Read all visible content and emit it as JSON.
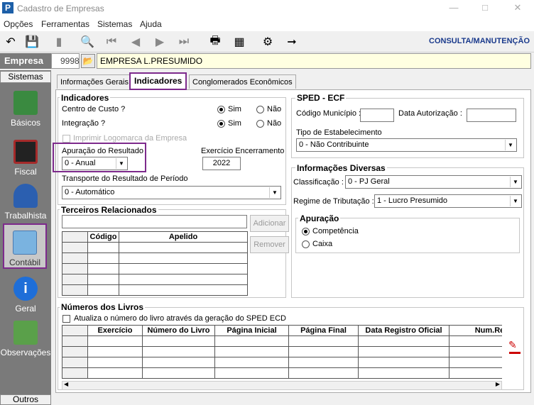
{
  "window": {
    "title": "Cadastro de Empresas",
    "app_icon": "P"
  },
  "menu": [
    "Opções",
    "Ferramentas",
    "Sistemas",
    "Ajuda"
  ],
  "toolbar": {
    "icons": [
      "undo-icon",
      "save-icon",
      "bookmark-icon",
      "print-preview-icon",
      "first-icon",
      "previous-icon",
      "next-icon",
      "last-icon",
      "printer-icon",
      "calculator-icon",
      "filter-icon",
      "exit-icon"
    ],
    "mode": "CONSULTA/MANUTENÇÃO"
  },
  "empresa": {
    "label": "Empresa",
    "code": "9998",
    "name": "EMPRESA L.PRESUMIDO"
  },
  "sidebar": {
    "header": "Sistemas",
    "footer": "Outros",
    "items": [
      {
        "label": "Básicos",
        "icon": "book-icon"
      },
      {
        "label": "Fiscal",
        "icon": "film-icon"
      },
      {
        "label": "Trabalhista",
        "icon": "worker-icon"
      },
      {
        "label": "Contábil",
        "icon": "calculator-icon"
      },
      {
        "label": "Geral",
        "icon": "info-icon"
      },
      {
        "label": "Observações",
        "icon": "pencil-icon"
      }
    ]
  },
  "tabs": [
    "Informações Gerais",
    "Indicadores",
    "Conglomerados Econômicos"
  ],
  "indicadores": {
    "title": "Indicadores",
    "centro_custo": {
      "label": "Centro de Custo ?",
      "sim": "Sim",
      "nao": "Não"
    },
    "integracao": {
      "label": "Integração ?",
      "sim": "Sim",
      "nao": "Não"
    },
    "imprimir_logo": "Imprimir Logomarca da Empresa",
    "apuracao_label": "Apuração do Resultado",
    "apuracao_value": "0 - Anual",
    "exercicio_label": "Exercício Encerramento",
    "exercicio_value": "2022",
    "transporte_label": "Transporte do Resultado de Período",
    "transporte_value": "0 - Automático"
  },
  "terceiros": {
    "title": "Terceiros Relacionados",
    "adicionar": "Adicionar",
    "remover": "Remover",
    "columns": [
      "Código",
      "Apelido"
    ]
  },
  "sped": {
    "title": "SPED - ECF",
    "cod_municipio": "Código Município :",
    "data_autorizacao": "Data Autorização :",
    "tipo_label": "Tipo de Estabelecimento",
    "tipo_value": "0 - Não Contribuinte"
  },
  "diversas": {
    "title": "Informações Diversas",
    "classificacao_label": "Classificação :",
    "classificacao_value": "0 - PJ Geral",
    "regime_label": "Regime de Tributação :",
    "regime_value": "1 - Lucro Presumido",
    "apuracao_title": "Apuração",
    "competencia": "Competência",
    "caixa": "Caixa"
  },
  "livros": {
    "title": "Números dos Livros",
    "checkbox": "Atualiza o número do livro através da geração do SPED ECD",
    "columns": [
      "Exercício",
      "Número do Livro",
      "Página Inicial",
      "Página Final",
      "Data Registro Oficial",
      "Num.Re"
    ]
  }
}
